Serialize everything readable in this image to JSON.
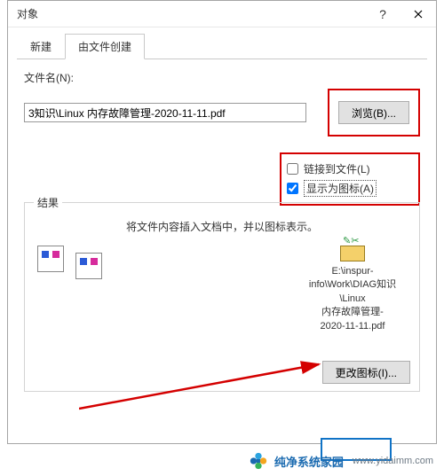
{
  "dialog": {
    "title": "对象",
    "tabs": {
      "new": "新建",
      "fromfile": "由文件创建"
    },
    "filename_label": "文件名(N):",
    "filename_value": "3知识\\Linux 内存故障管理-2020-11-11.pdf",
    "browse": "浏览(B)...",
    "link_to_file": "链接到文件(L)",
    "show_as_icon": "显示为图标(A)",
    "result_title": "结果",
    "result_desc": "将文件内容插入文档中，并以图标表示。",
    "selected_path": "E:\\inspur-info\\Work\\DIAG知识\\Linux\n内存故障管理-\n2020-11-11.pdf",
    "change_icon": "更改图标(I)..."
  },
  "footer": {
    "brand": "纯净系统家园",
    "url": "www.yidaimm.com"
  }
}
